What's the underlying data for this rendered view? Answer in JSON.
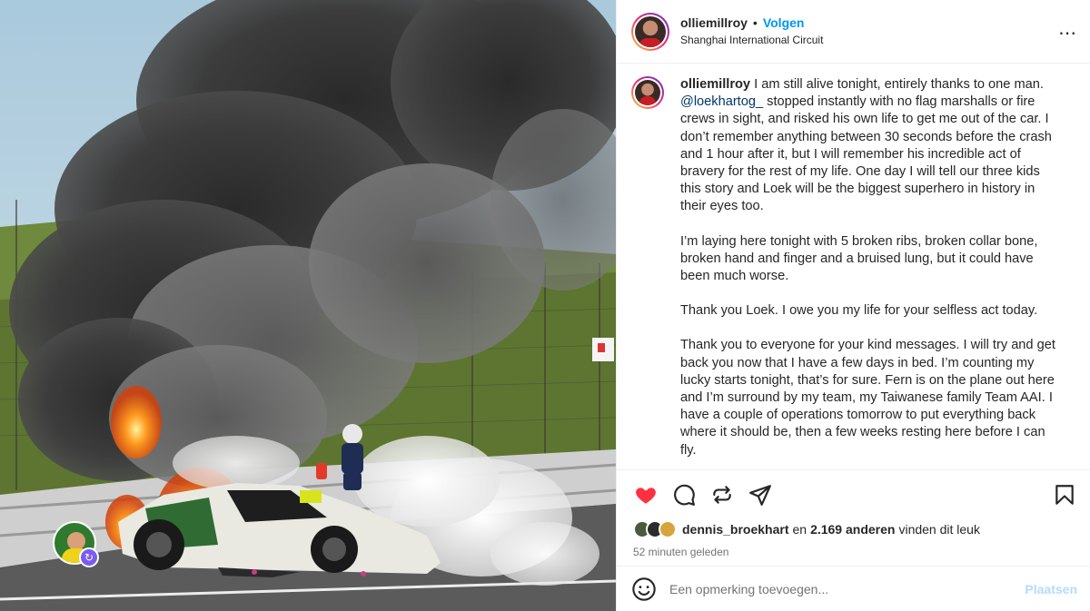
{
  "post": {
    "username": "olliemillroy",
    "follow_label": "Volgen",
    "separator": "•",
    "location": "Shanghai International Circuit",
    "more_icon": "more-horizontal-icon"
  },
  "caption": {
    "username": "olliemillroy",
    "mention": "@loekhartog_",
    "text_1": " I am still alive tonight, entirely thanks to one man. ",
    "text_2": " stopped instantly with no flag marshalls or fire crews in sight, and risked his own life to get me out of the car. I don’t remember anything between 30 seconds before the crash and 1 hour after it, but I will remember his incredible act of bravery for the rest of my life. One day I will tell our three kids this story and Loek will be the biggest superhero in history in their eyes too.",
    "paragraph_2": "I’m laying here tonight with 5 broken ribs, broken collar bone, broken hand and finger and a bruised lung, but it could have been much worse.",
    "paragraph_3": "Thank you Loek. I owe you my life for your selfless act today.",
    "paragraph_4": "Thank you to everyone for your kind messages. I will try and get back you now that I have a few days in bed. I’m counting my lucky starts tonight, that’s for sure. Fern is on the plane out here and I’m surround by my team, my Taiwanese family Team AAI. I have a couple of operations tomorrow to put everything back where it should be, then a few weeks resting here before I can fly."
  },
  "likes": {
    "liker": "dennis_broekhart",
    "connector": "en",
    "count": "2.169 anderen",
    "suffix": "vinden dit leuk"
  },
  "timestamp": "52 minuten geleden",
  "comment": {
    "placeholder": "Een opmerking toevoegen...",
    "post_label": "Plaatsen"
  },
  "colors": {
    "accent": "#0095f6",
    "like_red": "#ff3040",
    "post_disabled": "#b3dbff"
  }
}
